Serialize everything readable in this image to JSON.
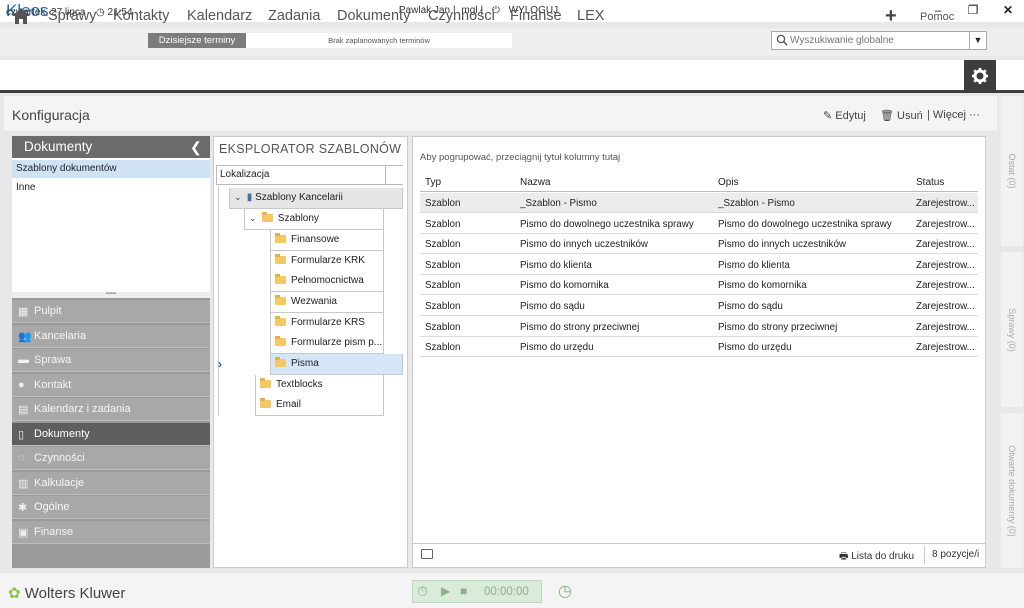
{
  "app": {
    "logo": "Kleos",
    "user": "Pawlak Jan",
    "user_short": "mgl",
    "logout": "WYLOGUJ"
  },
  "datebar": {
    "date": "czwartek, 27 lipca",
    "time": "21:54",
    "today_button": "Dzisiejsze terminy",
    "no_terms": "Brak zaplanowanych terminów",
    "search_placeholder": "Wyszukiwanie globalne"
  },
  "nav": {
    "items": [
      "Sprawy",
      "Kontakty",
      "Kalendarz",
      "Zadania",
      "Dokumenty",
      "Czynności",
      "Finanse",
      "LEX"
    ],
    "help": "Pomoc"
  },
  "config": {
    "title": "Konfiguracja",
    "edit": "Edytuj",
    "delete": "Usuń",
    "more": "Więcej"
  },
  "left": {
    "header": "Dokumenty",
    "items": [
      "Szablony dokumentów",
      "Inne"
    ],
    "modules": [
      "Pulpit",
      "Kancelaria",
      "Sprawa",
      "Kontakt",
      "Kalendarz i zadania",
      "Dokumenty",
      "Czynności",
      "Kalkulacje",
      "Ogólne",
      "Finanse"
    ]
  },
  "explorer": {
    "title": "EKSPLORATOR SZABLONÓW",
    "column": "Lokalizacja",
    "tree": {
      "root": "Szablony Kancelarii",
      "szablony": "Szablony",
      "folders": [
        "Finansowe",
        "Formularze KRK",
        "Pełnomocnictwa",
        "Wezwania",
        "Formularze KRS",
        "Formularze pism p...",
        "Pisma"
      ],
      "textblocks": "Textblocks",
      "email": "Email"
    }
  },
  "grid": {
    "group_hint": "Aby pogrupować, przeciągnij tytuł kolumny tutaj",
    "columns": [
      "Typ",
      "Nazwa",
      "Opis",
      "Status"
    ],
    "rows": [
      [
        "Szablon",
        "_Szablon - Pismo",
        "_Szablon - Pismo",
        "Zarejestrow..."
      ],
      [
        "Szablon",
        "Pismo do dowolnego uczestnika sprawy",
        "Pismo do dowolnego uczestnika sprawy",
        "Zarejestrow..."
      ],
      [
        "Szablon",
        "Pismo do innych uczestników",
        "Pismo do innych uczestników",
        "Zarejestrow..."
      ],
      [
        "Szablon",
        "Pismo do klienta",
        "Pismo do klienta",
        "Zarejestrow..."
      ],
      [
        "Szablon",
        "Pismo do komornika",
        "Pismo do komornika",
        "Zarejestrow..."
      ],
      [
        "Szablon",
        "Pismo do sądu",
        "Pismo do sądu",
        "Zarejestrow..."
      ],
      [
        "Szablon",
        "Pismo do strony przeciwnej",
        "Pismo do strony przeciwnej",
        "Zarejestrow..."
      ],
      [
        "Szablon",
        "Pismo do urzędu",
        "Pismo do urzędu",
        "Zarejestrow..."
      ]
    ],
    "print_list": "Lista do druku",
    "count": "8 pozycje/i"
  },
  "right_tabs": [
    "Ostat (0)",
    "Sprawy (0)",
    "Otwarte dokumenty (0)"
  ],
  "bottom": {
    "brand": "Wolters Kluwer",
    "timer": "00:00:00"
  },
  "colors": {
    "brand_blue": "#1f6fb5",
    "nav_dark": "#3d3d3d",
    "selection": "#cfe3f5"
  }
}
